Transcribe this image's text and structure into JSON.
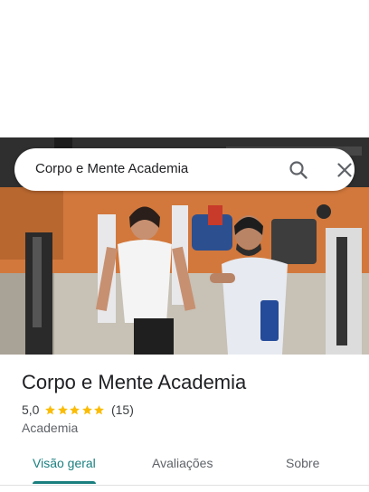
{
  "search": {
    "query": "Corpo e Mente Academia",
    "search_icon": "search-icon",
    "close_icon": "close-icon"
  },
  "hero": {
    "image_description_icon": "gym-photo"
  },
  "place": {
    "title": "Corpo e Mente Academia",
    "rating": "5,0",
    "stars": 5,
    "review_count": "(15)",
    "category": "Academia"
  },
  "tabs": [
    {
      "label": "Visão geral",
      "active": true
    },
    {
      "label": "Avaliações",
      "active": false
    },
    {
      "label": "Sobre",
      "active": false
    }
  ],
  "colors": {
    "accent": "#1a7f7f",
    "star": "#fbbc04",
    "text_primary": "#202124",
    "text_secondary": "#5f6368"
  }
}
